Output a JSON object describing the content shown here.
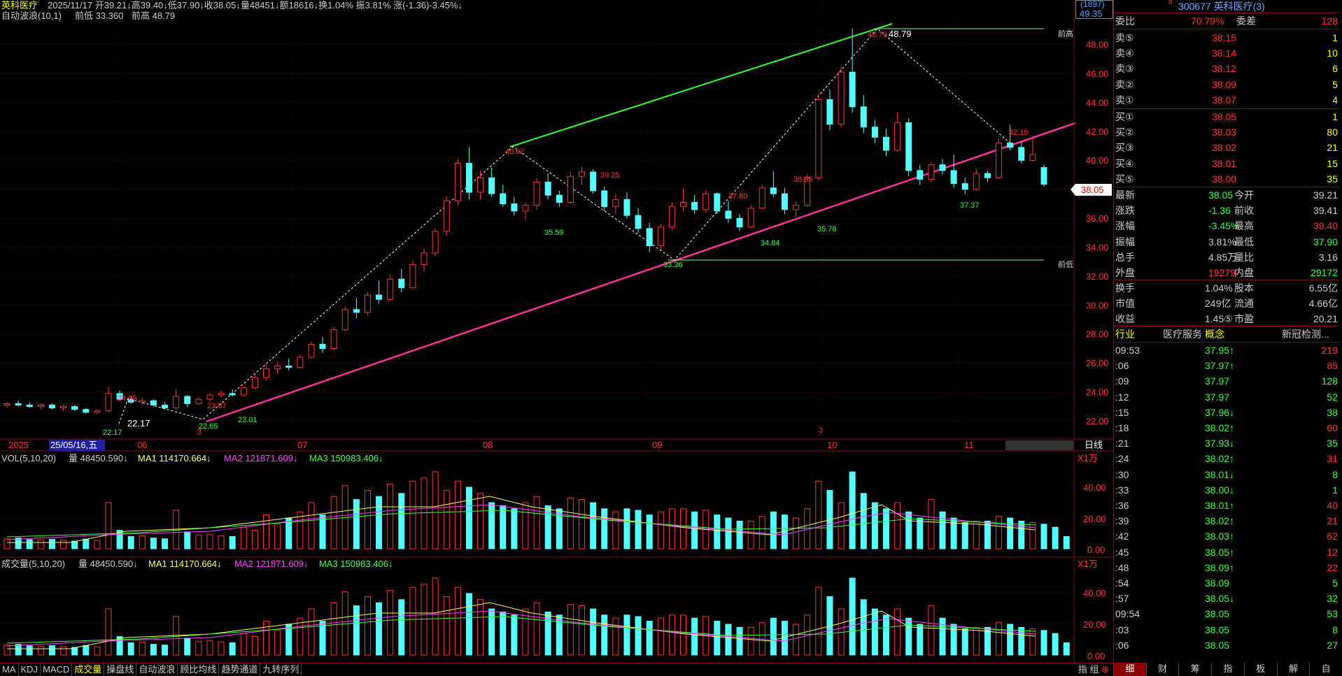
{
  "header": {
    "name": "英科医疗",
    "info": "2025/11/17 开39.21↓高39.40↓低37.90↓收38.05↓量48451↓额18616↓换1.04% 振3.81% 涨(-1.36)-3.45%↓",
    "wave_label": "自动波浪(10,1)",
    "prev_low": "前低 33.360",
    "prev_high": "前高 48.79"
  },
  "top_right": {
    "count": "(1897)",
    "price": "49.35"
  },
  "price_axis": [
    "48.00",
    "46.00",
    "44.00",
    "42.00",
    "40.00",
    "38.00",
    "36.00",
    "34.00",
    "32.00",
    "30.00",
    "28.00",
    "26.00",
    "24.00",
    "22.00"
  ],
  "current_price_tag": "38.05",
  "side_labels": {
    "high": "前高",
    "low": "前低"
  },
  "annotations": {
    "a1": "22.17",
    "a2": "24.05",
    "a3": "22.17",
    "a4": "23.87",
    "a5": "22.65",
    "a6": "23.01",
    "a7": "40.62",
    "a8": "35.59",
    "a9": "39.25",
    "a10": "33.36",
    "a11": "37.80",
    "a12": "34.84",
    "a13": "38.95",
    "a14": "35.78",
    "a15": "48.79",
    "a16": "42.15",
    "a17": "37.37",
    "a18": "48.79",
    "a19": "3"
  },
  "time_axis": {
    "y2025": "2025",
    "cursor": "25/05/16,五",
    "m06": "06",
    "m07": "07",
    "m08": "08",
    "m09": "09",
    "m10": "10",
    "m11": "11",
    "period": "日线"
  },
  "vol1": {
    "title": "VOL(5,10,20)",
    "qty": "量 48450.590↓",
    "ma1": "MA1 114170.664↓",
    "ma2": "MA2 121871.609↓",
    "ma3": "MA3 150983.406↓",
    "unit": "X1万",
    "ticks": [
      "40.00",
      "20.00",
      "0.00"
    ]
  },
  "vol2": {
    "title": "成交量(5,10,20)",
    "qty": "量 48450.590↓",
    "ma1": "MA1 114170.664↓",
    "ma2": "MA2 121871.609↓",
    "ma3": "MA3 150983.406↓",
    "unit": "X1万",
    "ticks": [
      "40.00",
      "20.00",
      "0.00"
    ]
  },
  "panel": {
    "code_title": "300677 英科医疗(3)",
    "ratio_label": "委比",
    "ratio": "70.79%",
    "diff_label": "委差",
    "diff": "128",
    "sells": [
      {
        "l": "卖⑤",
        "p": "38.15",
        "v": "1"
      },
      {
        "l": "卖④",
        "p": "38.14",
        "v": "10"
      },
      {
        "l": "卖③",
        "p": "38.12",
        "v": "6"
      },
      {
        "l": "卖②",
        "p": "38.09",
        "v": "5"
      },
      {
        "l": "卖①",
        "p": "38.07",
        "v": "4"
      }
    ],
    "buys": [
      {
        "l": "买①",
        "p": "38.05",
        "v": "1"
      },
      {
        "l": "买②",
        "p": "38.03",
        "v": "80"
      },
      {
        "l": "买③",
        "p": "38.02",
        "v": "21"
      },
      {
        "l": "买④",
        "p": "38.01",
        "v": "15"
      },
      {
        "l": "买⑤",
        "p": "38.00",
        "v": "35"
      }
    ],
    "stats": [
      {
        "a": "最新",
        "b": "38.05",
        "c": "今开",
        "d": "39.21"
      },
      {
        "a": "涨跌",
        "b": "-1.36",
        "c": "前收",
        "d": "39.41"
      },
      {
        "a": "涨幅",
        "b": "-3.45%",
        "c": "最高",
        "d": "39.40"
      },
      {
        "a": "振幅",
        "b": "3.81%",
        "c": "最低",
        "d": "37.90"
      },
      {
        "a": "总手",
        "b": "4.85万",
        "c": "量比",
        "d": "3.16"
      },
      {
        "a": "外盘",
        "b": "19279",
        "c": "内盘",
        "d": "29172"
      }
    ],
    "stats2": [
      {
        "a": "换手",
        "b": "1.04%",
        "c": "股本",
        "d": "6.55亿"
      },
      {
        "a": "市值",
        "b": "249亿",
        "c": "流通",
        "d": "4.66亿"
      },
      {
        "a": "收益",
        "b": "1.45⑤",
        "c": "市盈",
        "d": "20.21"
      }
    ],
    "industry_label": "行业",
    "industry": "医疗服务",
    "concept_label": "概念",
    "concept": "新冠检测...",
    "ticks": [
      {
        "t": "09:53",
        "p": "37.95↑",
        "v": "219"
      },
      {
        "t": ":06",
        "p": "37.97↑",
        "v": "85"
      },
      {
        "t": ":09",
        "p": "37.97",
        "v": "128"
      },
      {
        "t": ":12",
        "p": "37.97",
        "v": "52"
      },
      {
        "t": ":15",
        "p": "37.96↓",
        "v": "38"
      },
      {
        "t": ":18",
        "p": "38.02↑",
        "v": "60"
      },
      {
        "t": ":21",
        "p": "37.93↓",
        "v": "35"
      },
      {
        "t": ":24",
        "p": "38.02↑",
        "v": "31"
      },
      {
        "t": ":30",
        "p": "38.01↓",
        "v": "8"
      },
      {
        "t": ":33",
        "p": "38.00↓",
        "v": "1"
      },
      {
        "t": ":36",
        "p": "38.01↑",
        "v": "40"
      },
      {
        "t": ":39",
        "p": "38.02↑",
        "v": "21"
      },
      {
        "t": ":42",
        "p": "38.03↑",
        "v": "62"
      },
      {
        "t": ":45",
        "p": "38.05↑",
        "v": "12"
      },
      {
        "t": ":48",
        "p": "38.09↑",
        "v": "22"
      },
      {
        "t": ":54",
        "p": "38.09",
        "v": "5"
      },
      {
        "t": ":57",
        "p": "38.05↓",
        "v": "32"
      },
      {
        "t": "09:54",
        "p": "38.05",
        "v": "53"
      },
      {
        "t": ":03",
        "p": "38.05",
        "v": "8"
      },
      {
        "t": ":06",
        "p": "38.05",
        "v": "27"
      }
    ]
  },
  "bottom_tabs": [
    "MA",
    "KDJ",
    "MACD",
    "成交量",
    "操盘线",
    "自动波浪",
    "顾比均线",
    "趋势通道",
    "九转序列"
  ],
  "bottom_right": [
    "指",
    "组"
  ],
  "right_tabs": [
    "细",
    "财",
    "筹",
    "指",
    "板",
    "解",
    "自"
  ],
  "colors": {
    "up": "#ff3232",
    "down": "#54ffff",
    "trend_up": "#33ff33",
    "support": "#ff3399"
  },
  "chart_data": {
    "type": "candlestick",
    "ylim": [
      21.5,
      49.5
    ],
    "candles": [
      [
        22.8,
        23.0,
        22.6,
        22.9
      ],
      [
        22.9,
        23.1,
        22.7,
        22.8
      ],
      [
        22.8,
        23.0,
        22.6,
        22.7
      ],
      [
        22.7,
        22.9,
        22.5,
        22.8
      ],
      [
        22.8,
        22.9,
        22.5,
        22.6
      ],
      [
        22.6,
        22.8,
        22.4,
        22.7
      ],
      [
        22.7,
        22.8,
        22.4,
        22.5
      ],
      [
        22.5,
        22.6,
        22.2,
        22.3
      ],
      [
        22.3,
        22.5,
        22.17,
        22.4
      ],
      [
        22.4,
        24.05,
        22.3,
        23.6
      ],
      [
        23.6,
        23.8,
        23.1,
        23.2
      ],
      [
        23.2,
        23.4,
        22.9,
        23.0
      ],
      [
        23.0,
        23.3,
        22.8,
        23.1
      ],
      [
        23.1,
        23.2,
        22.7,
        22.8
      ],
      [
        22.8,
        23.0,
        22.5,
        22.6
      ],
      [
        22.6,
        23.87,
        22.5,
        23.4
      ],
      [
        23.4,
        23.5,
        22.65,
        22.9
      ],
      [
        22.9,
        23.3,
        22.8,
        23.2
      ],
      [
        23.2,
        23.6,
        23.01,
        23.5
      ],
      [
        23.5,
        23.8,
        23.3,
        23.6
      ],
      [
        23.6,
        23.9,
        23.4,
        23.5
      ],
      [
        23.5,
        24.1,
        23.4,
        24.0
      ],
      [
        24.0,
        24.9,
        23.9,
        24.7
      ],
      [
        24.7,
        25.6,
        24.5,
        25.3
      ],
      [
        25.3,
        25.8,
        25.0,
        25.5
      ],
      [
        25.5,
        26.0,
        25.2,
        25.4
      ],
      [
        25.4,
        26.3,
        25.3,
        26.1
      ],
      [
        26.1,
        27.2,
        26.0,
        27.0
      ],
      [
        27.0,
        27.5,
        26.4,
        26.7
      ],
      [
        26.7,
        28.2,
        26.6,
        28.0
      ],
      [
        28.0,
        29.6,
        27.9,
        29.4
      ],
      [
        29.4,
        30.2,
        28.8,
        29.2
      ],
      [
        29.2,
        30.6,
        29.0,
        30.4
      ],
      [
        30.4,
        31.4,
        29.8,
        30.1
      ],
      [
        30.1,
        31.8,
        30.0,
        31.5
      ],
      [
        31.5,
        32.2,
        30.6,
        30.9
      ],
      [
        30.9,
        32.8,
        30.8,
        32.5
      ],
      [
        32.5,
        33.6,
        32.0,
        33.3
      ],
      [
        33.3,
        35.0,
        33.1,
        34.8
      ],
      [
        34.8,
        37.2,
        34.5,
        36.9
      ],
      [
        36.9,
        39.8,
        36.6,
        39.5
      ],
      [
        39.5,
        40.62,
        37.0,
        37.5
      ],
      [
        37.5,
        39.0,
        37.0,
        38.5
      ],
      [
        38.5,
        39.2,
        37.2,
        37.4
      ],
      [
        37.4,
        38.0,
        36.5,
        36.7
      ],
      [
        36.7,
        37.2,
        35.9,
        36.2
      ],
      [
        36.2,
        36.8,
        35.59,
        36.6
      ],
      [
        36.6,
        38.5,
        36.3,
        38.2
      ],
      [
        38.2,
        38.8,
        37.0,
        37.3
      ],
      [
        37.3,
        37.6,
        36.5,
        36.8
      ],
      [
        36.8,
        38.9,
        36.7,
        38.6
      ],
      [
        38.6,
        39.25,
        38.0,
        38.9
      ],
      [
        38.9,
        39.1,
        37.4,
        37.6
      ],
      [
        37.6,
        37.9,
        36.2,
        36.5
      ],
      [
        36.5,
        37.4,
        36.0,
        37.0
      ],
      [
        37.0,
        37.5,
        35.7,
        35.9
      ],
      [
        35.9,
        36.4,
        34.7,
        35.0
      ],
      [
        35.0,
        35.4,
        33.36,
        33.8
      ],
      [
        33.8,
        35.3,
        33.5,
        35.1
      ],
      [
        35.1,
        36.8,
        34.9,
        36.5
      ],
      [
        36.5,
        37.8,
        36.2,
        36.8
      ],
      [
        36.8,
        37.3,
        36.0,
        36.3
      ],
      [
        36.3,
        37.6,
        36.1,
        37.4
      ],
      [
        37.4,
        37.5,
        36.0,
        36.2
      ],
      [
        36.2,
        36.9,
        35.4,
        35.7
      ],
      [
        35.7,
        36.0,
        34.84,
        35.1
      ],
      [
        35.1,
        36.6,
        35.0,
        36.4
      ],
      [
        36.4,
        38.0,
        36.3,
        37.8
      ],
      [
        37.8,
        38.95,
        37.2,
        37.4
      ],
      [
        37.4,
        37.8,
        36.0,
        36.3
      ],
      [
        36.3,
        36.9,
        35.78,
        36.6
      ],
      [
        36.6,
        38.7,
        36.5,
        38.5
      ],
      [
        38.5,
        44.3,
        38.3,
        43.9
      ],
      [
        43.9,
        44.6,
        41.8,
        42.2
      ],
      [
        42.2,
        46.2,
        42.0,
        45.8
      ],
      [
        45.8,
        48.79,
        43.0,
        43.4
      ],
      [
        43.4,
        44.2,
        41.6,
        42.0
      ],
      [
        42.0,
        42.5,
        40.9,
        41.3
      ],
      [
        41.3,
        41.9,
        40.0,
        40.4
      ],
      [
        40.4,
        43.0,
        40.3,
        42.3
      ],
      [
        42.3,
        42.6,
        38.6,
        39.0
      ],
      [
        39.0,
        39.4,
        38.0,
        38.4
      ],
      [
        38.4,
        39.6,
        38.2,
        39.4
      ],
      [
        39.4,
        39.8,
        38.7,
        39.0
      ],
      [
        39.0,
        40.1,
        37.8,
        38.1
      ],
      [
        38.1,
        38.5,
        37.37,
        37.7
      ],
      [
        37.7,
        39.1,
        37.6,
        38.8
      ],
      [
        38.8,
        39.0,
        38.2,
        38.5
      ],
      [
        38.5,
        41.2,
        38.4,
        40.9
      ],
      [
        40.9,
        42.15,
        40.4,
        40.6
      ],
      [
        40.6,
        41.0,
        39.5,
        39.7
      ],
      [
        39.7,
        41.4,
        39.6,
        40.1
      ],
      [
        39.21,
        39.4,
        37.9,
        38.05
      ]
    ],
    "volumes": [
      6.5,
      7,
      6,
      5.8,
      6.2,
      5.5,
      5,
      6.3,
      5.4,
      30,
      12,
      8,
      8.5,
      7,
      6.5,
      25,
      11,
      9,
      9.5,
      8.5,
      8,
      14,
      12,
      22,
      16,
      20,
      24,
      30,
      22,
      34,
      41,
      32,
      38,
      34,
      42,
      36,
      44,
      46,
      50,
      38,
      44,
      40,
      36,
      30,
      28,
      26,
      30,
      34,
      28,
      26,
      33,
      32,
      30,
      26,
      24,
      26,
      25,
      22,
      24,
      26,
      26,
      24,
      25,
      22,
      20,
      18,
      18,
      21,
      24,
      22,
      20,
      26,
      44,
      38,
      30,
      50,
      36,
      30,
      26,
      30,
      24,
      20,
      32,
      24,
      20,
      17,
      18,
      18,
      21,
      20,
      18,
      17,
      16,
      14,
      8
    ],
    "xlabels": [
      "2025",
      "25/05/16,五",
      "06",
      "07",
      "08",
      "09",
      "10",
      "11"
    ]
  }
}
